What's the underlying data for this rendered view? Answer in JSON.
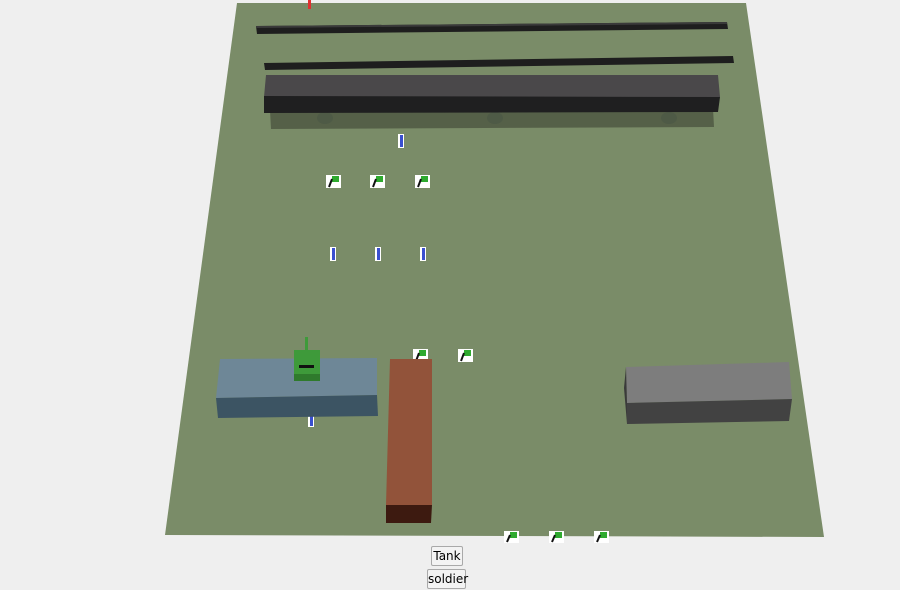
{
  "controls": {
    "tank_label": "Tank",
    "soldier_label": "soldier"
  },
  "scene": {
    "ground_color": "#7a8c68",
    "background_color": "#efefef",
    "tank_color": "#3e9a3a",
    "flag_color": "#2faa2f",
    "soldier_color": "#3a4fd0",
    "marker_color": "#e03030",
    "blue_block_color": "#6e8797",
    "orange_block_color": "#92533a",
    "gray_block_color": "#7d7d7d",
    "dark_wall_color": "#4a484a"
  }
}
